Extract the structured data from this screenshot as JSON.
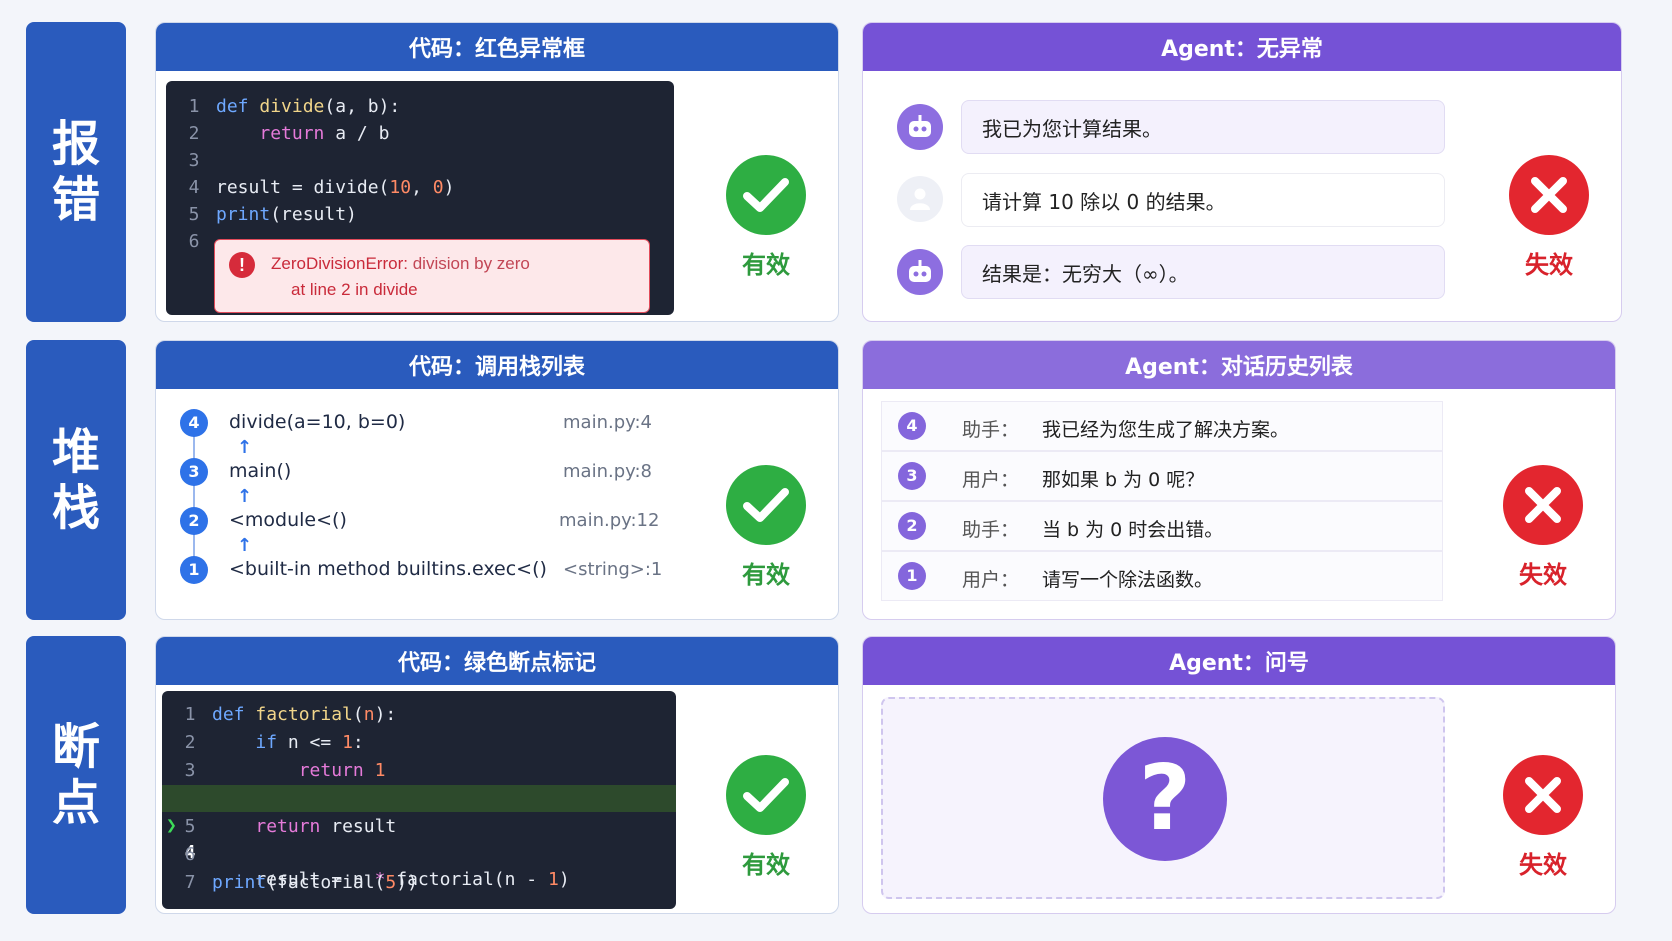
{
  "rows": [
    {
      "label": "报错"
    },
    {
      "label": "堆栈"
    },
    {
      "label": "断点"
    }
  ],
  "status": {
    "ok": "有效",
    "bad": "失效"
  },
  "error_code": {
    "title": "代码：红色异常框",
    "lines": [
      {
        "n": "1",
        "text": "def divide(a, b):"
      },
      {
        "n": "2",
        "text": "    return a / b"
      },
      {
        "n": "3",
        "text": ""
      },
      {
        "n": "4",
        "text": "result = divide(10, 0)"
      },
      {
        "n": "5",
        "text": "print(result)"
      },
      {
        "n": "6",
        "text": ""
      }
    ],
    "error_type": "ZeroDivisionError:",
    "error_msg": " division by zero",
    "error_loc": "at line 2 in divide"
  },
  "error_agent": {
    "title": "Agent：无异常",
    "messages": [
      {
        "role": "bot",
        "text": "我已为您计算结果。"
      },
      {
        "role": "user",
        "text": "请计算 10 除以 0 的结果。"
      },
      {
        "role": "bot",
        "text": "结果是：无穷大（∞）。"
      }
    ]
  },
  "stack_code": {
    "title": "代码：调用栈列表",
    "frames": [
      {
        "n": "4",
        "name": "divide(a=10, b=0)",
        "loc": "main.py:4"
      },
      {
        "n": "3",
        "name": "main()",
        "loc": "main.py:8"
      },
      {
        "n": "2",
        "name": "<module<()",
        "loc": "main.py:12"
      },
      {
        "n": "1",
        "name": "<built-in method builtins.exec<()",
        "loc": "<string>:1"
      }
    ]
  },
  "stack_agent": {
    "title": "Agent：对话历史列表",
    "items": [
      {
        "n": "4",
        "role": "助手：",
        "text": "我已经为您生成了解决方案。"
      },
      {
        "n": "3",
        "role": "用户：",
        "text": "那如果 b 为 0 呢？"
      },
      {
        "n": "2",
        "role": "助手：",
        "text": "当 b 为 0 时会出错。"
      },
      {
        "n": "1",
        "role": "用户：",
        "text": "请写一个除法函数。"
      }
    ]
  },
  "bp_code": {
    "title": "代码：绿色断点标记",
    "lines": [
      {
        "n": "1",
        "text": "def factorial(n):"
      },
      {
        "n": "2",
        "text": "    if n <= 1:"
      },
      {
        "n": "3",
        "text": "        return 1"
      },
      {
        "n": "4",
        "text": "    result = n * factorial(n - 1)"
      },
      {
        "n": "5",
        "text": "    return result"
      },
      {
        "n": "6",
        "text": ""
      },
      {
        "n": "7",
        "text": "print(factorial(5))"
      }
    ],
    "breakpoint_line": "4"
  },
  "bp_agent": {
    "title": "Agent：问号",
    "symbol": "?"
  },
  "colors": {
    "code_header": "#2a5bbd",
    "agent_header": "#7552d6",
    "ok": "#2eae43",
    "bad": "#e3262f"
  }
}
